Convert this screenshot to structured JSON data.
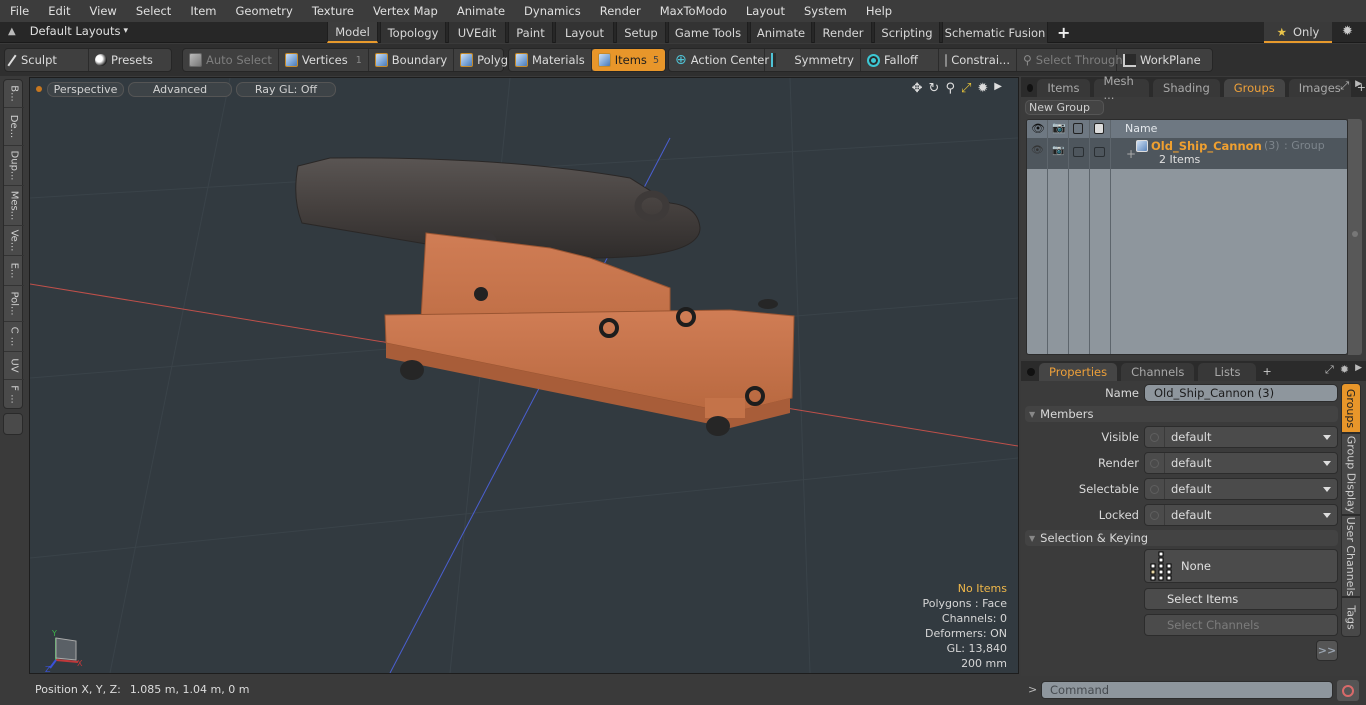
{
  "menu": [
    "File",
    "Edit",
    "View",
    "Select",
    "Item",
    "Geometry",
    "Texture",
    "Vertex Map",
    "Animate",
    "Dynamics",
    "Render",
    "MaxToModo",
    "Layout",
    "System",
    "Help"
  ],
  "layouts": {
    "label": "Default Layouts",
    "caret": "▾",
    "up_icon": "▲"
  },
  "layout_tabs": [
    {
      "label": "Model",
      "active": true
    },
    {
      "label": "Topology"
    },
    {
      "label": "UVEdit"
    },
    {
      "label": "Paint"
    },
    {
      "label": "Layout"
    },
    {
      "label": "Setup"
    },
    {
      "label": "Game Tools"
    },
    {
      "label": "Animate"
    },
    {
      "label": "Render"
    },
    {
      "label": "Scripting"
    },
    {
      "label": "Schematic Fusion"
    }
  ],
  "tabbar": {
    "add": "+",
    "only_label": "Only",
    "star": "★",
    "gear": "✹"
  },
  "toolbar": {
    "sculpt": "Sculpt",
    "presets": "Presets",
    "auto_select": "Auto Select",
    "vertices": "Vertices",
    "vertices_count": "1",
    "boundary": "Boundary",
    "polygons": "Polygons",
    "materials": "Materials",
    "items": "Items",
    "items_count": "5",
    "action_center": "Action Center",
    "symmetry": "Symmetry",
    "falloff": "Falloff",
    "constraints": "Constrai...",
    "select_through": "Select Through",
    "workplane": "WorkPlane"
  },
  "left_tabs": [
    "B...",
    "De...",
    "Dup...",
    "Mes...",
    "Ve...",
    "E...",
    "Pol...",
    "C ...",
    "UV",
    "F ..."
  ],
  "viewport": {
    "view": "Perspective",
    "shading": "Advanced",
    "raygl": "Ray GL: Off",
    "stats": {
      "selection": "No Items",
      "mode": "Polygons : Face",
      "channels": "Channels: 0",
      "deformers": "Deformers: ON",
      "gl": "GL: 13,840",
      "scale": "200 mm"
    },
    "axis": {
      "x": "X",
      "y": "Y",
      "z": "Z"
    }
  },
  "status": {
    "position_label": "Position X, Y, Z:",
    "position_value": "1.085 m, 1.04 m, 0 m"
  },
  "top_panel": {
    "tabs": [
      {
        "label": "Items"
      },
      {
        "label": "Mesh ..."
      },
      {
        "label": "Shading"
      },
      {
        "label": "Groups",
        "active": true
      },
      {
        "label": "Images"
      }
    ],
    "add": "+",
    "new_group": "New Group",
    "column_name": "Name",
    "groups": [
      {
        "name": "Old_Ship_Cannon",
        "count": "(3)",
        "type": ": Group",
        "items": "2 Items",
        "expand": "+"
      }
    ]
  },
  "bottom_panel": {
    "tabs": [
      {
        "label": "Properties",
        "active": true
      },
      {
        "label": "Channels"
      },
      {
        "label": "Lists"
      }
    ],
    "add": "+",
    "name_label": "Name",
    "name_value": "Old_Ship_Cannon (3)",
    "members_section": "Members",
    "fields": [
      {
        "label": "Visible",
        "value": "default"
      },
      {
        "label": "Render",
        "value": "default"
      },
      {
        "label": "Selectable",
        "value": "default"
      },
      {
        "label": "Locked",
        "value": "default"
      }
    ],
    "keying_section": "Selection & Keying",
    "none_label": "None",
    "select_items": "Select Items",
    "select_channels": "Select Channels",
    "more": ">>",
    "side_tabs": [
      {
        "label": "Groups",
        "active": true
      },
      {
        "label": "Group Display"
      },
      {
        "label": "User Channels"
      },
      {
        "label": "Tags"
      }
    ]
  },
  "command": {
    "prompt": ">",
    "placeholder": "Command"
  }
}
